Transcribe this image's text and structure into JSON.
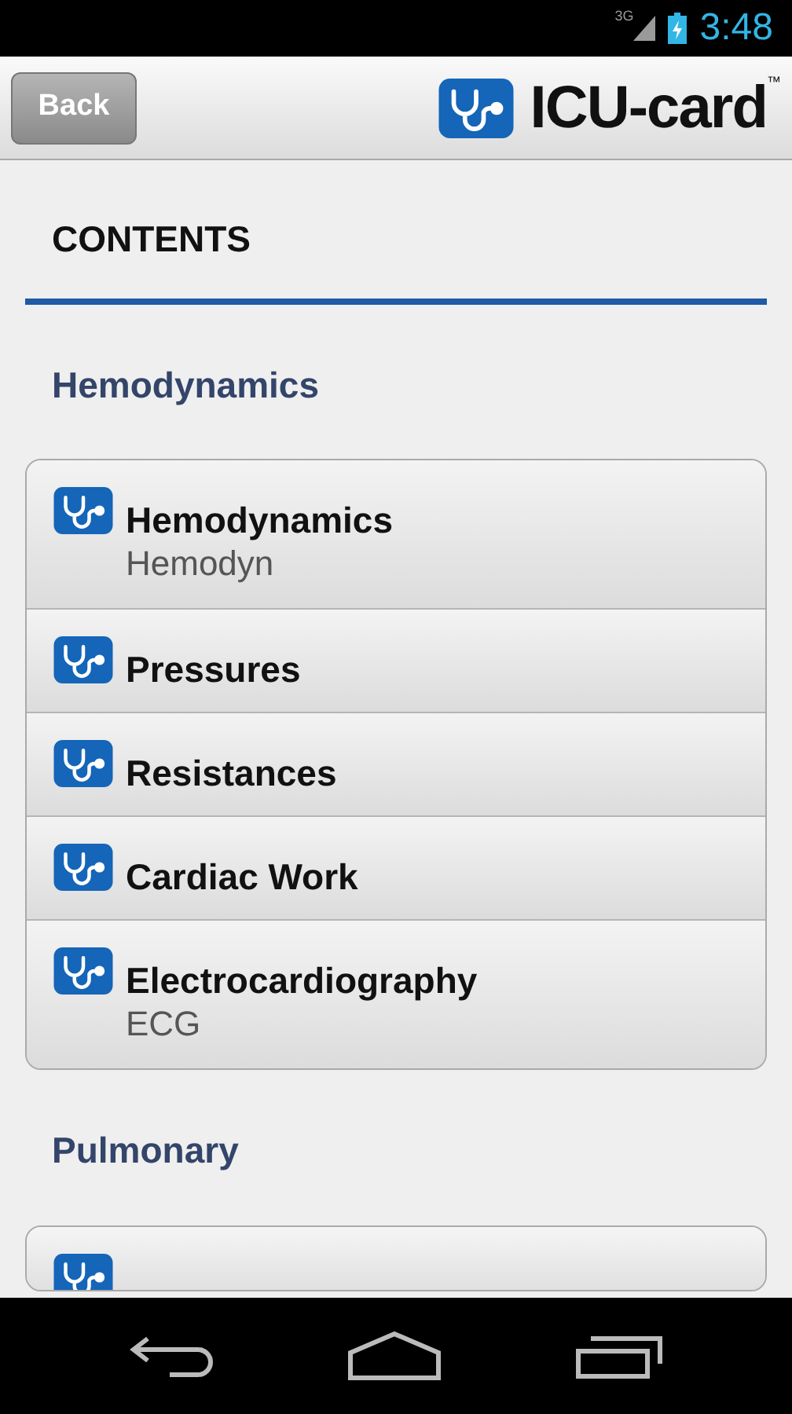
{
  "status_bar": {
    "network": "3G",
    "time": "3:48"
  },
  "header": {
    "back_label": "Back",
    "logo_text": "ICU-card",
    "logo_mark": "™"
  },
  "page_title": "CONTENTS",
  "sections": [
    {
      "title": "Hemodynamics",
      "items": [
        {
          "title": "Hemodynamics",
          "subtitle": "Hemodyn"
        },
        {
          "title": "Pressures"
        },
        {
          "title": "Resistances"
        },
        {
          "title": "Cardiac Work"
        },
        {
          "title": "Electrocardiography",
          "subtitle": "ECG"
        }
      ]
    },
    {
      "title": "Pulmonary",
      "items": [
        {
          "kind": "cut"
        }
      ]
    }
  ]
}
